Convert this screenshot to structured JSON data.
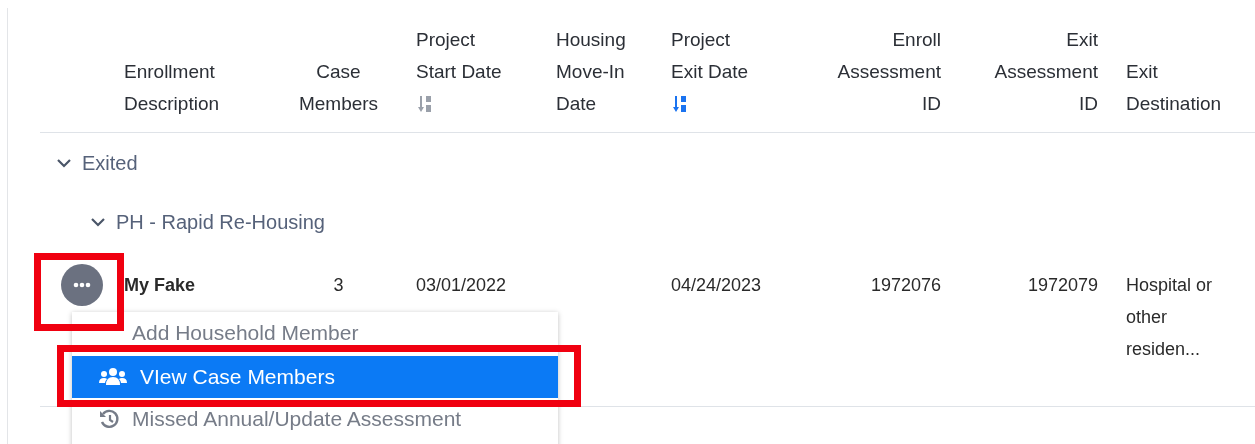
{
  "table": {
    "columns": [
      {
        "label": "Enrollment\nDescription"
      },
      {
        "label": "Case\nMembers"
      },
      {
        "label": "Project\nStart Date",
        "sort_active": false
      },
      {
        "label": "Housing\nMove-In\nDate"
      },
      {
        "label": "Project\nExit Date",
        "sort_active": true
      },
      {
        "label": "Enroll\nAssessment\nID"
      },
      {
        "label": "Exit\nAssessment\nID"
      },
      {
        "label": "Exit\nDestination"
      }
    ],
    "groups": [
      {
        "label": "Exited",
        "expanded": true,
        "children": [
          {
            "label": "PH - Rapid Re-Housing",
            "expanded": true,
            "rows": [
              {
                "cells": [
                  "My Fake",
                  "3",
                  "03/01/2022",
                  "",
                  "04/24/2023",
                  "1972076",
                  "1972079",
                  "Hospital or\nother\nresiden..."
                ]
              }
            ]
          }
        ]
      }
    ]
  },
  "menu": {
    "items": [
      {
        "label": "Add Household Member",
        "selected": false
      },
      {
        "label": "VIew Case Members",
        "selected": true
      },
      {
        "label": "Missed Annual/Update Assessment",
        "selected": false
      }
    ]
  }
}
